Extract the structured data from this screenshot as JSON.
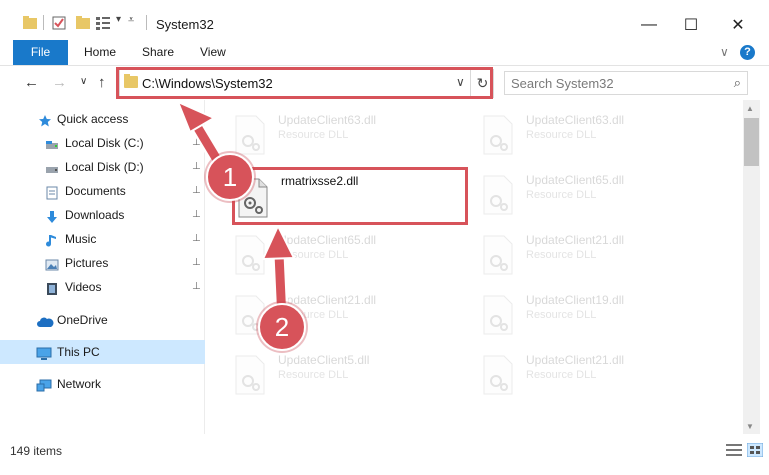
{
  "window": {
    "title": "System32",
    "minimize_glyph": "—",
    "maximize_glyph": "☐",
    "close_glyph": "✕"
  },
  "ribbon": {
    "tabs": [
      "File",
      "Home",
      "Share",
      "View"
    ],
    "expand_glyph": "∨",
    "help_glyph": "?"
  },
  "address": {
    "path": "C:\\Windows\\System32",
    "chevron_glyph": "∨",
    "refresh_glyph": "↻"
  },
  "search": {
    "placeholder": "Search System32",
    "icon_glyph": "⌕"
  },
  "nav": {
    "back_glyph": "←",
    "forward_glyph": "→",
    "recent_glyph": "∨",
    "up_glyph": "↑"
  },
  "sidebar": {
    "items": [
      {
        "label": "Quick access",
        "icon": "star-icon",
        "pinned": false
      },
      {
        "label": "Local Disk (C:)",
        "icon": "drive-icon",
        "pinned": true
      },
      {
        "label": "Local Disk (D:)",
        "icon": "drive-icon",
        "pinned": true
      },
      {
        "label": "Documents",
        "icon": "documents-icon",
        "pinned": true
      },
      {
        "label": "Downloads",
        "icon": "download-icon",
        "pinned": true
      },
      {
        "label": "Music",
        "icon": "music-icon",
        "pinned": true
      },
      {
        "label": "Pictures",
        "icon": "pictures-icon",
        "pinned": true
      },
      {
        "label": "Videos",
        "icon": "videos-icon",
        "pinned": true
      },
      {
        "label": "OneDrive",
        "icon": "cloud-icon",
        "pinned": false
      },
      {
        "label": "This PC",
        "icon": "computer-icon",
        "pinned": false,
        "selected": true
      },
      {
        "label": "Network",
        "icon": "network-icon",
        "pinned": false
      }
    ],
    "pin_glyph": "📌"
  },
  "files": {
    "selected": {
      "name": "rmatrixsse2.dll"
    },
    "ghost_tiles": [
      {
        "name": "UpdateClient63.dll",
        "type": "Resource DLL"
      },
      {
        "name": "UpdateClient63.dll",
        "type": "Resource DLL"
      },
      {
        "name": "UpdateClient65.dll",
        "type": "Resource DLL"
      },
      {
        "name": "UpdateClient65.dll",
        "type": "Resource DLL"
      },
      {
        "name": "UpdateClient21.dll",
        "type": "Resource DLL"
      },
      {
        "name": "UpdateClient21.dll",
        "type": "Resource DLL"
      },
      {
        "name": "UpdateClient19.dll",
        "type": "Resource DLL"
      },
      {
        "name": "UpdateClient5.dll",
        "type": "Resource DLL"
      },
      {
        "name": "UpdateClient21.dll",
        "type": "Resource DLL"
      }
    ]
  },
  "status": {
    "item_count": "149 items"
  },
  "annotations": {
    "badge_1": "1",
    "badge_2": "2"
  },
  "colors": {
    "accent": "#1979ca",
    "highlight_red": "#d7535a",
    "selected_nav": "#cde8ff",
    "folder": "#e8c766"
  }
}
